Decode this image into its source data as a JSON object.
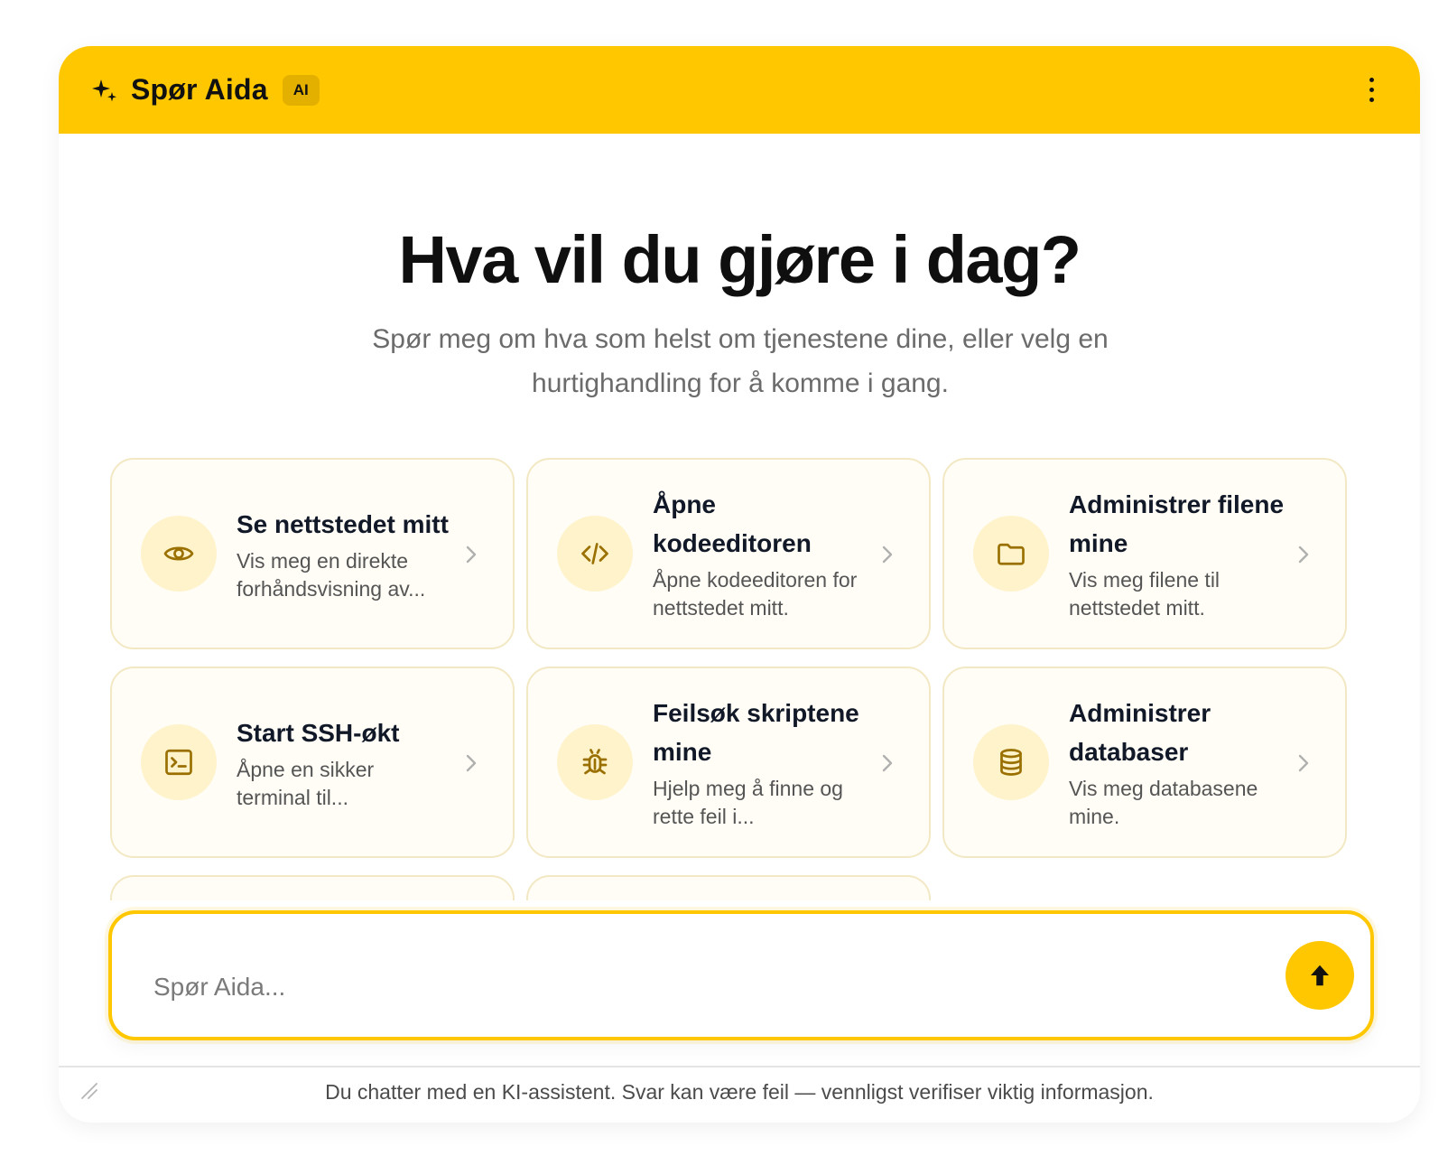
{
  "header": {
    "icon": "sparkle-icon",
    "title": "Spør Aida",
    "badge": "AI",
    "menu_icon": "more-vertical-icon"
  },
  "hero": {
    "title": "Hva vil du gjøre i dag?",
    "subtitle": "Spør meg om hva som helst om tjenestene dine, eller velg en hurtighandling for å komme i gang."
  },
  "actions": [
    {
      "icon": "eye-icon",
      "title": "Se nettstedet mitt",
      "description": "Vis meg en direkte forhåndsvisning av..."
    },
    {
      "icon": "code-icon",
      "title": "Åpne kodeeditoren",
      "description": "Åpne kodeeditoren for nettstedet mitt."
    },
    {
      "icon": "folder-icon",
      "title": "Administrer filene mine",
      "description": "Vis meg filene til nettstedet mitt."
    },
    {
      "icon": "terminal-icon",
      "title": "Start SSH-økt",
      "description": "Åpne en sikker terminal til..."
    },
    {
      "icon": "bug-icon",
      "title": "Feilsøk skriptene mine",
      "description": "Hjelp meg å finne og rette feil i..."
    },
    {
      "icon": "database-icon",
      "title": "Administrer databaser",
      "description": "Vis meg databasene mine."
    }
  ],
  "input": {
    "placeholder": "Spør Aida...",
    "value": "",
    "send_icon": "arrow-up-icon"
  },
  "footer": {
    "disclaimer": "Du chatter med en KI-assistent. Svar kan være feil — vennligst verifiser viktig informasjon."
  },
  "colors": {
    "accent": "#ffc700",
    "icon_color": "#9a7000",
    "card_bg": "#fffdf5",
    "card_border": "#f3e8c4"
  }
}
